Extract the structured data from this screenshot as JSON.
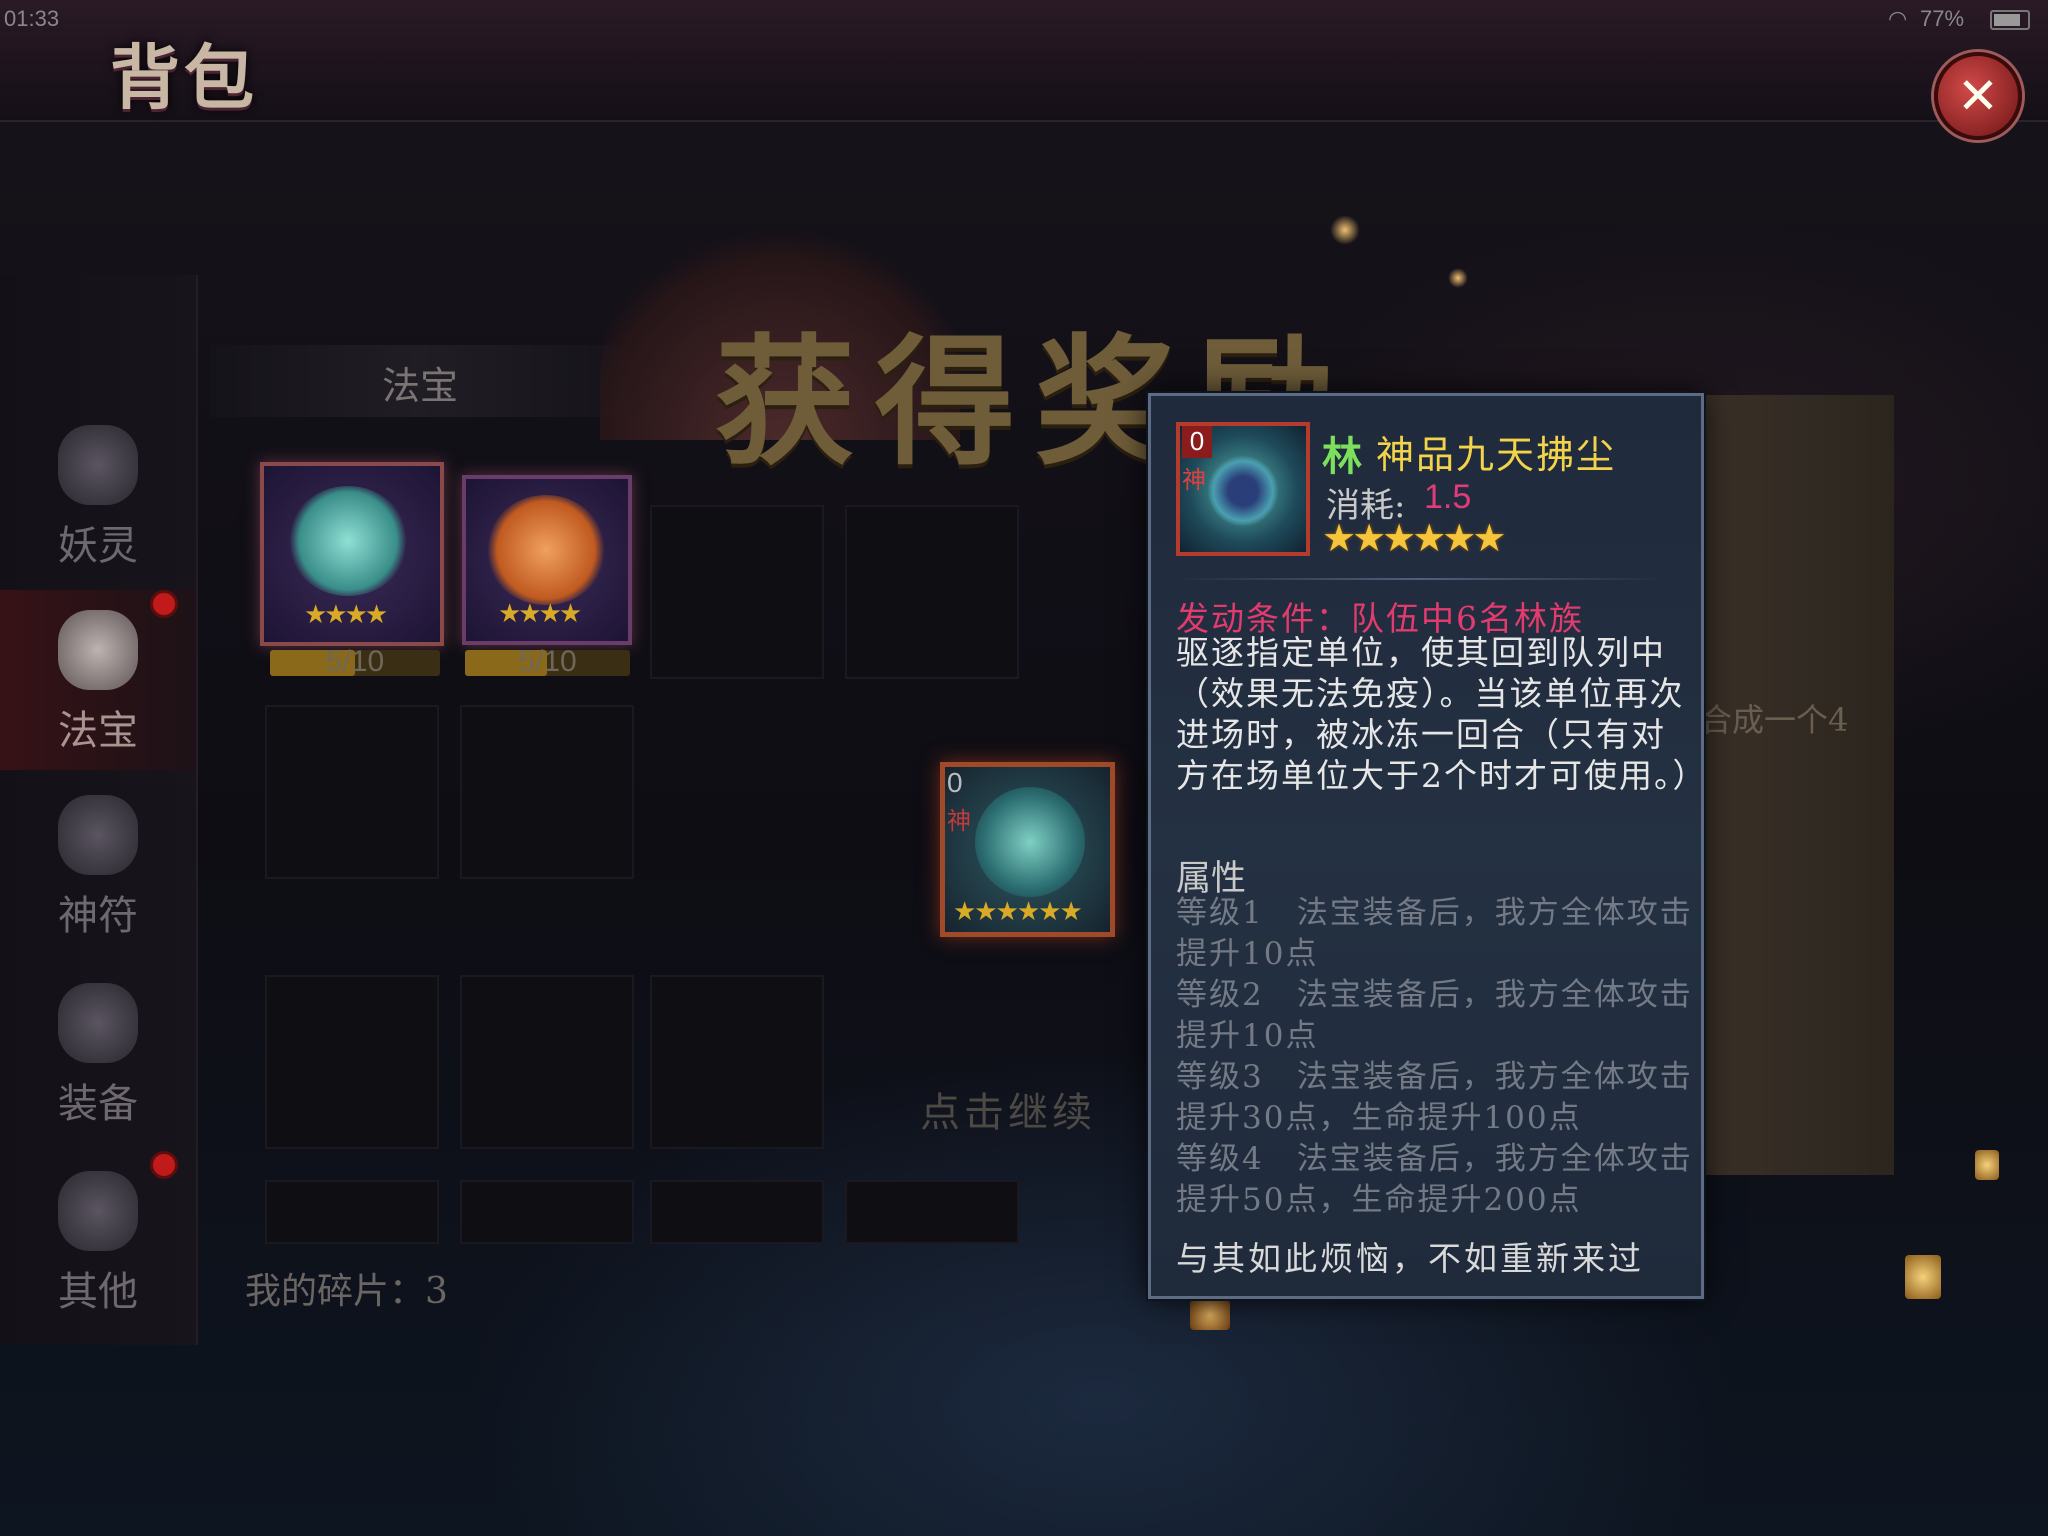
{
  "status_bar": {
    "time": "01:33",
    "battery": "77%"
  },
  "header": {
    "title": "背包"
  },
  "sidebar": {
    "items": [
      {
        "label": "妖灵",
        "icon": "flame-icon",
        "badge": false,
        "active": false
      },
      {
        "label": "法宝",
        "icon": "gourd-icon",
        "badge": true,
        "active": true
      },
      {
        "label": "神符",
        "icon": "talisman-icon",
        "badge": false,
        "active": false
      },
      {
        "label": "装备",
        "icon": "crossed-swords-icon",
        "badge": false,
        "active": false
      },
      {
        "label": "其他",
        "icon": "beast-icon",
        "badge": true,
        "active": false
      }
    ]
  },
  "section": {
    "tab_title": "法宝"
  },
  "treasure_cards": [
    {
      "name": "cloud-whisk",
      "stars": "★★★★",
      "progress": "5/10",
      "fraction": 0.5,
      "color": "#4fb3a8"
    },
    {
      "name": "fox-tail",
      "stars": "★★★★",
      "progress": "5/10",
      "fraction": 0.5,
      "color": "#d8742f"
    }
  ],
  "reward": {
    "banner": "获得奖励",
    "item": {
      "count": "0",
      "tag": "神",
      "stars": "★★★★★★"
    },
    "continue_hint": "点击继续"
  },
  "fragments_label": "我的碎片：3",
  "scroll_text": "合成一个4",
  "tooltip": {
    "icon": {
      "count": "0",
      "tag": "神"
    },
    "clan": "林",
    "name": "神品九天拂尘",
    "cost_label": "消耗:",
    "cost": "1.5",
    "stars": "★★★★★★",
    "condition": "发动条件：队伍中6名林族",
    "description": "驱逐指定单位，使其回到队列中（效果无法免疫）。当该单位再次进场时，被冰冻一回合（只有对方在场单位大于2个时才可使用。）",
    "attributes_title": "属性",
    "levels": [
      "等级1　法宝装备后，我方全体攻击提升10点",
      "等级2　法宝装备后，我方全体攻击提升10点",
      "等级3　法宝装备后，我方全体攻击提升30点，生命提升100点",
      "等级4　法宝装备后，我方全体攻击提升50点，生命提升200点"
    ],
    "flavor": "与其如此烦恼，不如重新来过"
  }
}
